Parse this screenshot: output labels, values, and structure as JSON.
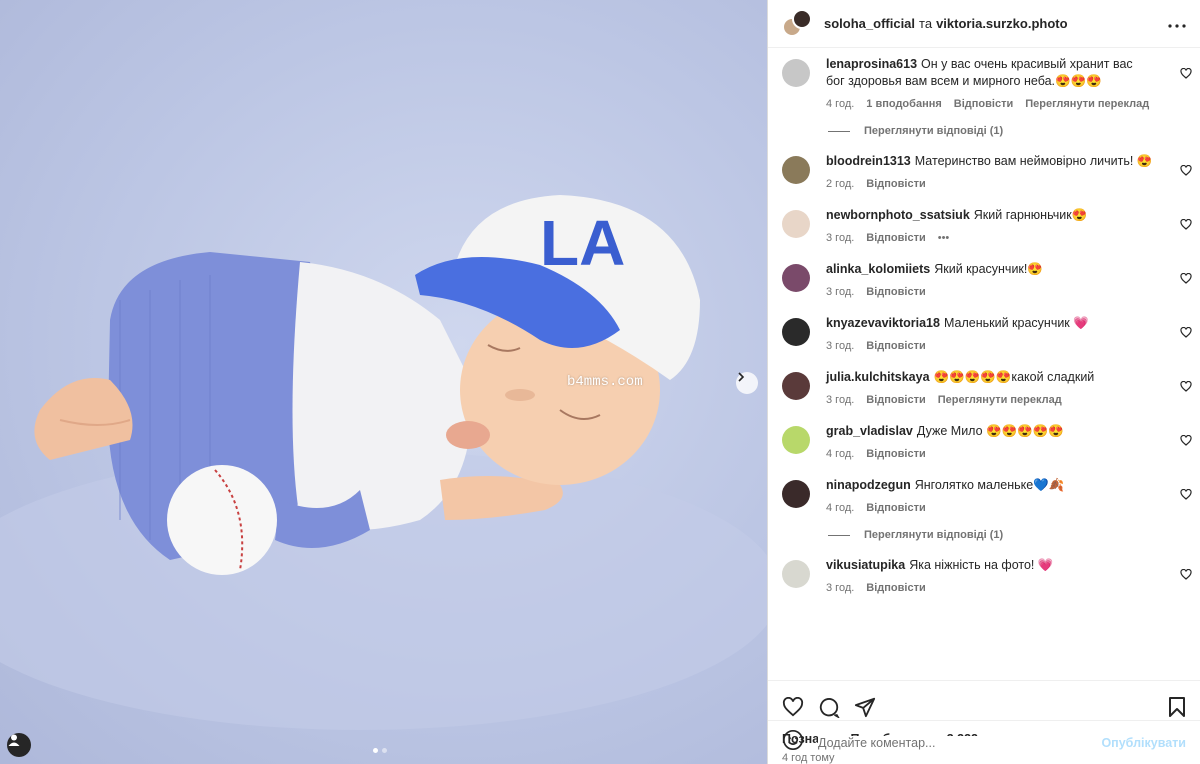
{
  "header": {
    "user1": "soloha_official",
    "and": "та",
    "user2": "viktoria.surzko.photo"
  },
  "media": {
    "watermark": "b4mms.com",
    "cap_logo": "LA"
  },
  "comments": [
    {
      "user": "lenaprosina613",
      "text": "Он у вас очень красивый хранит вас бог здоровья вам всем и мирного неба.😍😍😍",
      "time": "4 год.",
      "likes": "1 вподобання",
      "reply": "Відповісти",
      "translate": "Переглянути переклад",
      "avatar_color": "#c7c7c7",
      "view_replies": "Переглянути відповіді (1)"
    },
    {
      "user": "bloodrein1313",
      "text": "Материнство вам неймовірно личить! 😍",
      "time": "2 год.",
      "reply": "Відповісти",
      "avatar_color": "#8a7a5a"
    },
    {
      "user": "newbornphoto_ssatsiuk",
      "text": "Який гарнюньчик😍",
      "time": "3 год.",
      "reply": "Відповісти",
      "more": "•••",
      "avatar_color": "#e8d6c8"
    },
    {
      "user": "alinka_kolomiiets",
      "text": "Який красунчик!😍",
      "time": "3 год.",
      "reply": "Відповісти",
      "avatar_color": "#7a4a6a"
    },
    {
      "user": "knyazevaviktoria18",
      "text": "Маленький красунчик 💗",
      "time": "3 год.",
      "reply": "Відповісти",
      "avatar_color": "#2a2a2a"
    },
    {
      "user": "julia.kulchitskaya",
      "text": "😍😍😍😍😍какой сладкий",
      "time": "3 год.",
      "reply": "Відповісти",
      "translate": "Переглянути переклад",
      "avatar_color": "#5a3a3a"
    },
    {
      "user": "grab_vladislav",
      "text": "Дуже Мило 😍😍😍😍😍",
      "time": "4 год.",
      "reply": "Відповісти",
      "avatar_color": "#b8d86a"
    },
    {
      "user": "ninapodzegun",
      "text": "Янголятко маленьке💙🍂",
      "time": "4 год.",
      "reply": "Відповісти",
      "avatar_color": "#3a2a2a",
      "view_replies": "Переглянути відповіді (1)"
    },
    {
      "user": "vikusiatupika",
      "text": "Яка ніжність на фото! 💗",
      "time": "3 год.",
      "reply": "Відповісти",
      "avatar_color": "#d8d8d0"
    }
  ],
  "footer": {
    "likes_label": "Позначки «Подобається»: 3 332",
    "time_ago": "4 год тому",
    "add_comment_placeholder": "Додайте коментар...",
    "post_label": "Опублікувати"
  }
}
